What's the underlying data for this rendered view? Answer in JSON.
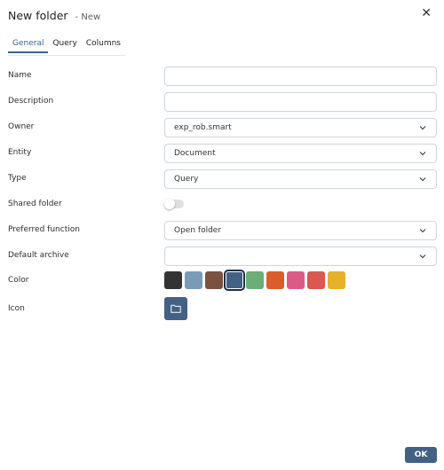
{
  "dialog": {
    "title": "New folder",
    "subtitle": "- New",
    "close_symbol": "✕"
  },
  "tabs": [
    {
      "label": "General",
      "active": true
    },
    {
      "label": "Query",
      "active": false
    },
    {
      "label": "Columns",
      "active": false
    }
  ],
  "form": {
    "name": {
      "label": "Name",
      "value": ""
    },
    "description": {
      "label": "Description",
      "value": ""
    },
    "owner": {
      "label": "Owner",
      "value": "exp_rob.smart"
    },
    "entity": {
      "label": "Entity",
      "value": "Document"
    },
    "type": {
      "label": "Type",
      "value": "Query"
    },
    "shared_folder": {
      "label": "Shared folder",
      "checked": false
    },
    "preferred_function": {
      "label": "Preferred function",
      "value": "Open folder"
    },
    "default_archive": {
      "label": "Default archive",
      "value": ""
    },
    "color": {
      "label": "Color",
      "options": [
        "#333333",
        "#7a9bb8",
        "#7a5240",
        "#426185",
        "#6bae76",
        "#dd5c2c",
        "#dd5a87",
        "#d9584f",
        "#e7b12c"
      ],
      "selected_index": 3
    },
    "icon": {
      "label": "Icon",
      "icon_name": "folder-icon"
    }
  },
  "footer": {
    "ok_label": "OK"
  },
  "colors": {
    "accent": "#3f6287",
    "ok_button": "#426185",
    "icon_button": "#426185"
  }
}
